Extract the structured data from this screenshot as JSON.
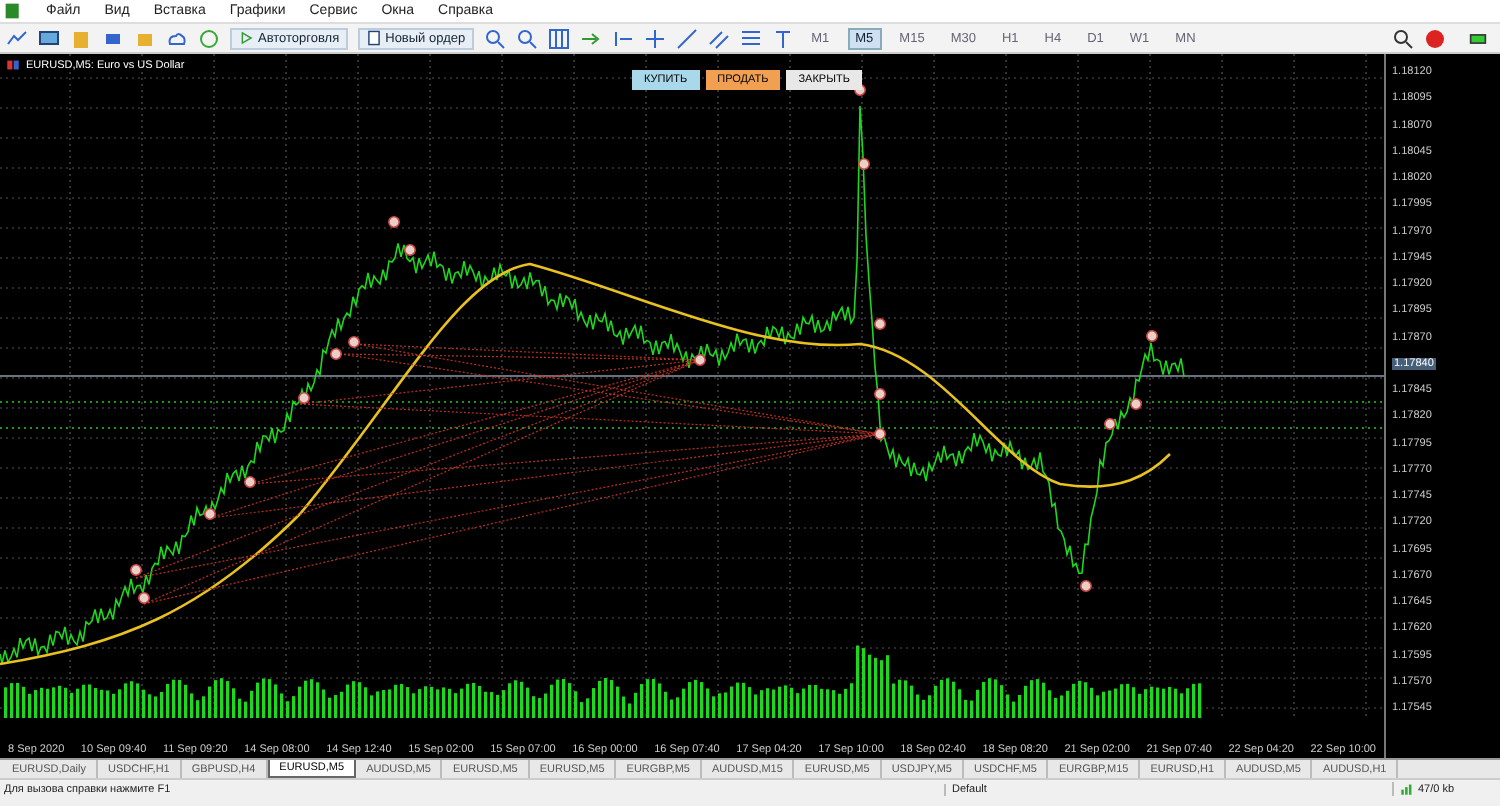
{
  "menu": [
    "Файл",
    "Вид",
    "Вставка",
    "Графики",
    "Сервис",
    "Окна",
    "Справка"
  ],
  "toolbar": {
    "buttons": [
      {
        "label": "Автоторговля",
        "kind": "autotrade"
      },
      {
        "label": "Новый ордер",
        "kind": "order"
      }
    ],
    "timeframes": [
      {
        "label": "M1",
        "selected": false
      },
      {
        "label": "M5",
        "selected": true
      },
      {
        "label": "M15",
        "selected": false
      },
      {
        "label": "M30",
        "selected": false
      },
      {
        "label": "H1",
        "selected": false
      },
      {
        "label": "H4",
        "selected": false
      },
      {
        "label": "D1",
        "selected": false
      },
      {
        "label": "W1",
        "selected": false
      },
      {
        "label": "MN",
        "selected": false
      }
    ]
  },
  "chart": {
    "title": "EURUSD,M5: Euro vs US Dollar",
    "trade_buttons": [
      {
        "label": "КУПИТЬ",
        "kind": "buy"
      },
      {
        "label": "ПРОДАТЬ",
        "kind": "sell"
      },
      {
        "label": "ЗАКРЫТЬ",
        "kind": "close"
      }
    ],
    "price_axis": [
      "1.18120",
      "1.18095",
      "1.18070",
      "1.18045",
      "1.18020",
      "1.17995",
      "1.17970",
      "1.17945",
      "1.17920",
      "1.17895",
      "1.17870",
      "1.17845",
      "1.17820",
      "1.17795",
      "1.17770",
      "1.17745",
      "1.17720",
      "1.17695",
      "1.17670",
      "1.17645",
      "1.17620",
      "1.17595",
      "1.17570",
      "1.17545"
    ],
    "current_price": "1.17840",
    "time_axis": [
      "8 Sep 2020",
      "10 Sep 09:40",
      "11 Sep 09:20",
      "14 Sep 08:00",
      "14 Sep 12:40",
      "15 Sep 02:00",
      "15 Sep 07:00",
      "16 Sep 00:00",
      "16 Sep 07:40",
      "17 Sep 04:20",
      "17 Sep 10:00",
      "18 Sep 02:40",
      "18 Sep 08:20",
      "21 Sep 02:00",
      "21 Sep 07:40",
      "22 Sep 04:20",
      "22 Sep 10:00"
    ]
  },
  "chart_tabs": [
    {
      "label": "EURUSD,Daily",
      "selected": false
    },
    {
      "label": "USDCHF,H1",
      "selected": false
    },
    {
      "label": "GBPUSD,H4",
      "selected": false
    },
    {
      "label": "EURUSD,M5",
      "selected": true
    },
    {
      "label": "AUDUSD,M5",
      "selected": false
    },
    {
      "label": "EURUSD,M5",
      "selected": false
    },
    {
      "label": "EURUSD,M5",
      "selected": false
    },
    {
      "label": "EURGBP,M5",
      "selected": false
    },
    {
      "label": "AUDUSD,M15",
      "selected": false
    },
    {
      "label": "EURUSD,M5",
      "selected": false
    },
    {
      "label": "USDJPY,M5",
      "selected": false
    },
    {
      "label": "USDCHF,M5",
      "selected": false
    },
    {
      "label": "EURGBP,M15",
      "selected": false
    },
    {
      "label": "EURUSD,H1",
      "selected": false
    },
    {
      "label": "AUDUSD,M5",
      "selected": false
    },
    {
      "label": "AUDUSD,H1",
      "selected": false
    }
  ],
  "status_bar": {
    "help": "Для вызова справки нажмите F1",
    "profile": "Default",
    "traffic": "47/0 kb"
  }
}
